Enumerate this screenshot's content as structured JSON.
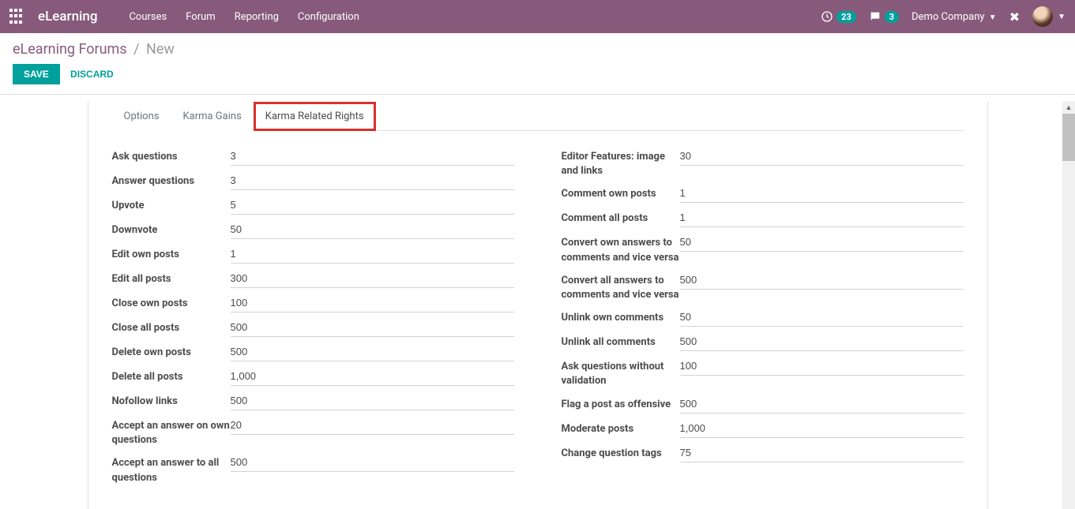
{
  "header": {
    "app_title": "eLearning",
    "nav": [
      "Courses",
      "Forum",
      "Reporting",
      "Configuration"
    ],
    "activity_count": "23",
    "message_count": "3",
    "company": "Demo Company"
  },
  "breadcrumb": {
    "root": "eLearning Forums",
    "sep": "/",
    "current": "New"
  },
  "actions": {
    "save": "SAVE",
    "discard": "DISCARD"
  },
  "tabs": [
    {
      "label": "Options",
      "active": false
    },
    {
      "label": "Karma Gains",
      "active": false
    },
    {
      "label": "Karma Related Rights",
      "active": true,
      "highlighted": true
    }
  ],
  "left_fields": [
    {
      "label": "Ask questions",
      "value": "3"
    },
    {
      "label": "Answer questions",
      "value": "3"
    },
    {
      "label": "Upvote",
      "value": "5"
    },
    {
      "label": "Downvote",
      "value": "50"
    },
    {
      "label": "Edit own posts",
      "value": "1"
    },
    {
      "label": "Edit all posts",
      "value": "300"
    },
    {
      "label": "Close own posts",
      "value": "100"
    },
    {
      "label": "Close all posts",
      "value": "500"
    },
    {
      "label": "Delete own posts",
      "value": "500"
    },
    {
      "label": "Delete all posts",
      "value": "1,000"
    },
    {
      "label": "Nofollow links",
      "value": "500"
    },
    {
      "label": "Accept an answer on own questions",
      "value": "20"
    },
    {
      "label": "Accept an answer to all questions",
      "value": "500"
    }
  ],
  "right_fields": [
    {
      "label": "Editor Features: image and links",
      "value": "30"
    },
    {
      "label": "Comment own posts",
      "value": "1"
    },
    {
      "label": "Comment all posts",
      "value": "1"
    },
    {
      "label": "Convert own answers to comments and vice versa",
      "value": "50"
    },
    {
      "label": "Convert all answers to comments and vice versa",
      "value": "500"
    },
    {
      "label": "Unlink own comments",
      "value": "50"
    },
    {
      "label": "Unlink all comments",
      "value": "500"
    },
    {
      "label": "Ask questions without validation",
      "value": "100"
    },
    {
      "label": "Flag a post as offensive",
      "value": "500"
    },
    {
      "label": "Moderate posts",
      "value": "1,000"
    },
    {
      "label": "Change question tags",
      "value": "75"
    }
  ]
}
